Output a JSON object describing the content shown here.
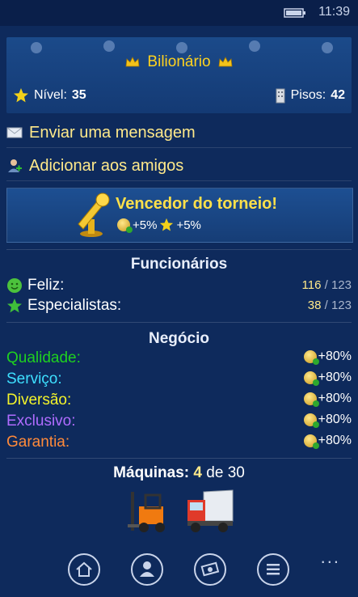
{
  "status_bar": {
    "time": "11:39"
  },
  "profile": {
    "rank_title": "Bilionário",
    "level_label": "Nível:",
    "level_value": "35",
    "floors_label": "Pisos:",
    "floors_value": "42"
  },
  "actions": [
    {
      "label": "Enviar uma mensagem",
      "icon": "envelope-icon"
    },
    {
      "label": "Adicionar aos amigos",
      "icon": "add-friend-icon"
    }
  ],
  "tournament": {
    "title": "Vencedor do torneio!",
    "bonus_coins": "+5%",
    "bonus_stars": "+5%"
  },
  "employees": {
    "title": "Funcionários",
    "rows": [
      {
        "label": "Feliz:",
        "value": "116",
        "sep": "/",
        "total": "123"
      },
      {
        "label": "Especialistas:",
        "value": "38",
        "sep": "/",
        "total": "123"
      }
    ]
  },
  "business": {
    "title": "Negócio",
    "rows": [
      {
        "label": "Qualidade:",
        "value": "+80%",
        "color": "#1fd11f"
      },
      {
        "label": "Serviço:",
        "value": "+80%",
        "color": "#3ee0ff"
      },
      {
        "label": "Diversão:",
        "value": "+80%",
        "color": "#f4f42a"
      },
      {
        "label": "Exclusivo:",
        "value": "+80%",
        "color": "#b06cff"
      },
      {
        "label": "Garantia:",
        "value": "+80%",
        "color": "#ff8a3a"
      }
    ]
  },
  "machines": {
    "label": "Máquinas:",
    "count": "4",
    "of": "de",
    "total": "30"
  },
  "nav": {
    "items": [
      "home-icon",
      "profile-icon",
      "money-icon",
      "list-icon"
    ],
    "more": "..."
  }
}
